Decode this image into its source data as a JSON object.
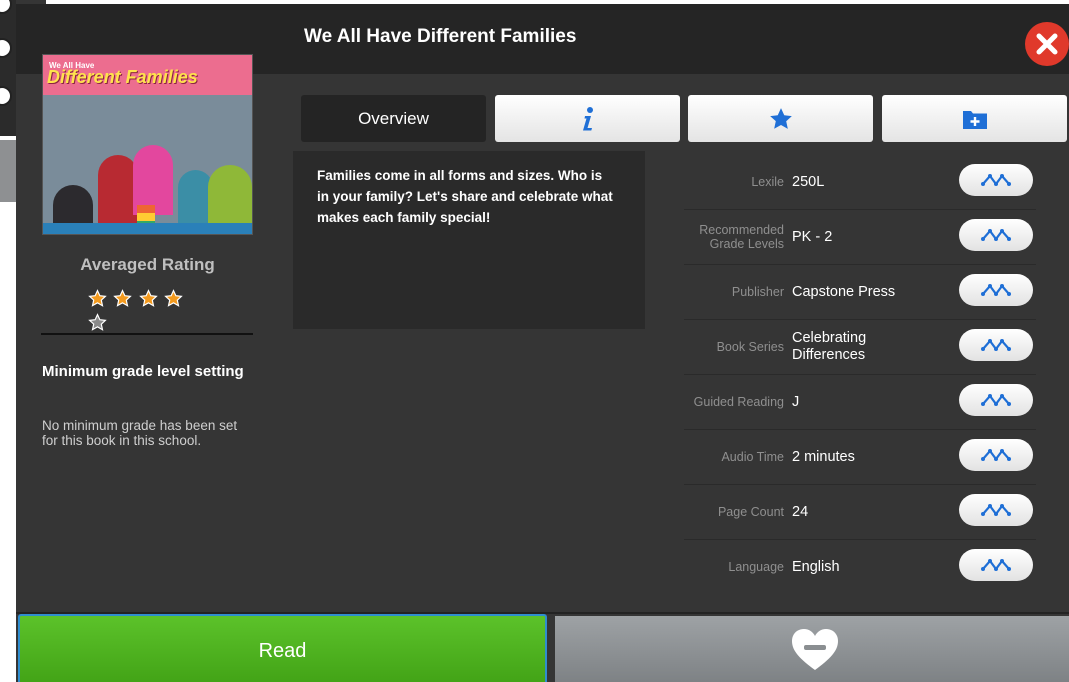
{
  "title": "We All Have Different Families",
  "cover": {
    "small_text": "We All Have",
    "title_text": "Different Families"
  },
  "rating": {
    "label": "Averaged Rating",
    "value": 4,
    "out_of": 5
  },
  "min_grade": {
    "title": "Minimum grade level setting",
    "body": "No minimum grade has been set for this book in this school."
  },
  "tabs": {
    "overview_label": "Overview",
    "info_icon": "info-icon",
    "favorite_icon": "star-icon",
    "add_folder_icon": "folder-add-icon"
  },
  "description": "Families come in all forms and sizes. Who is in your family? Let's share and celebrate what makes each family special!",
  "details": [
    {
      "label": "Lexile",
      "value": "250L"
    },
    {
      "label": "Recommended Grade Levels",
      "value": "PK - 2"
    },
    {
      "label": "Publisher",
      "value": "Capstone Press"
    },
    {
      "label": "Book Series",
      "value": "Celebrating Differences"
    },
    {
      "label": "Guided Reading",
      "value": "J"
    },
    {
      "label": "Audio Time",
      "value": "2 minutes"
    },
    {
      "label": "Page Count",
      "value": "24"
    },
    {
      "label": "Language",
      "value": "English"
    }
  ],
  "buttons": {
    "read_label": "Read",
    "favorite_icon": "heart-minus-icon"
  },
  "colors": {
    "accent_blue": "#1f6fd6",
    "read_green": "#4cb51e",
    "close_red": "#e0392b",
    "star_orange": "#f39a1e"
  }
}
